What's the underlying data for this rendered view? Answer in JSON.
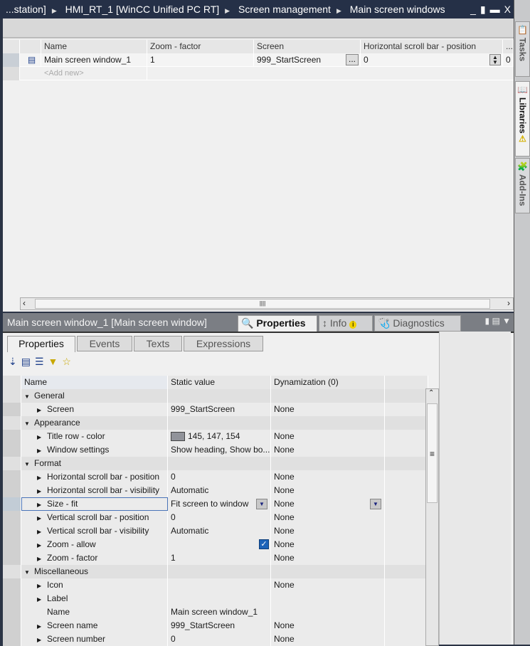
{
  "breadcrumb": [
    "...station]",
    "HMI_RT_1 [WinCC Unified PC RT]",
    "Screen management",
    "Main screen windows"
  ],
  "window_buttons": {
    "minimize": "_",
    "float": "▮",
    "maximize": "▬",
    "close": "X"
  },
  "side_tabs": [
    "Tasks",
    "Libraries",
    "Add-Ins"
  ],
  "editor": {
    "columns": [
      "Name",
      "Zoom - factor",
      "Screen",
      "Horizontal scroll bar - position",
      "..."
    ],
    "rows": [
      {
        "name": "Main screen window_1",
        "zoom": "1",
        "screen": "999_StartScreen",
        "hpos": "0",
        "more": "0"
      }
    ],
    "add_new": "<Add new>",
    "browse": "..."
  },
  "inspector": {
    "title": "Main screen window_1 [Main screen window]",
    "tabs": [
      "Properties",
      "Info",
      "Diagnostics"
    ],
    "subtabs": [
      "Properties",
      "Events",
      "Texts",
      "Expressions"
    ],
    "columns": [
      "Name",
      "Static value",
      "Dynamization (0)"
    ],
    "rows": [
      {
        "name": "General",
        "group": true
      },
      {
        "name": "Screen",
        "value": "999_StartScreen",
        "dyn": "None"
      },
      {
        "name": "Appearance",
        "group": true
      },
      {
        "name": "Title row - color",
        "value": "145, 147, 154",
        "dyn": "None",
        "swatch": "#91939a"
      },
      {
        "name": "Window settings",
        "value": "Show heading, Show bo...",
        "dyn": "None"
      },
      {
        "name": "Format",
        "group": true
      },
      {
        "name": "Horizontal scroll bar - position",
        "value": "0",
        "dyn": "None"
      },
      {
        "name": "Horizontal scroll bar - visibility",
        "value": "Automatic",
        "dyn": "None"
      },
      {
        "name": "Size - fit",
        "value": "Fit screen to window",
        "dyn": "None",
        "selected": true
      },
      {
        "name": "Vertical scroll bar - position",
        "value": "0",
        "dyn": "None"
      },
      {
        "name": "Vertical scroll bar - visibility",
        "value": "Automatic",
        "dyn": "None"
      },
      {
        "name": "Zoom - allow",
        "value": "",
        "dyn": "None",
        "checked": true
      },
      {
        "name": "Zoom - factor",
        "value": "1",
        "dyn": "None"
      },
      {
        "name": "Miscellaneous",
        "group": true
      },
      {
        "name": "Icon",
        "value": "",
        "dyn": "None"
      },
      {
        "name": "Label",
        "value": "",
        "dyn": ""
      },
      {
        "name": "Name",
        "value": "Main screen window_1",
        "dyn": "",
        "noarrow": true
      },
      {
        "name": "Screen name",
        "value": "999_StartScreen",
        "dyn": "None"
      },
      {
        "name": "Screen number",
        "value": "0",
        "dyn": "None"
      }
    ]
  }
}
